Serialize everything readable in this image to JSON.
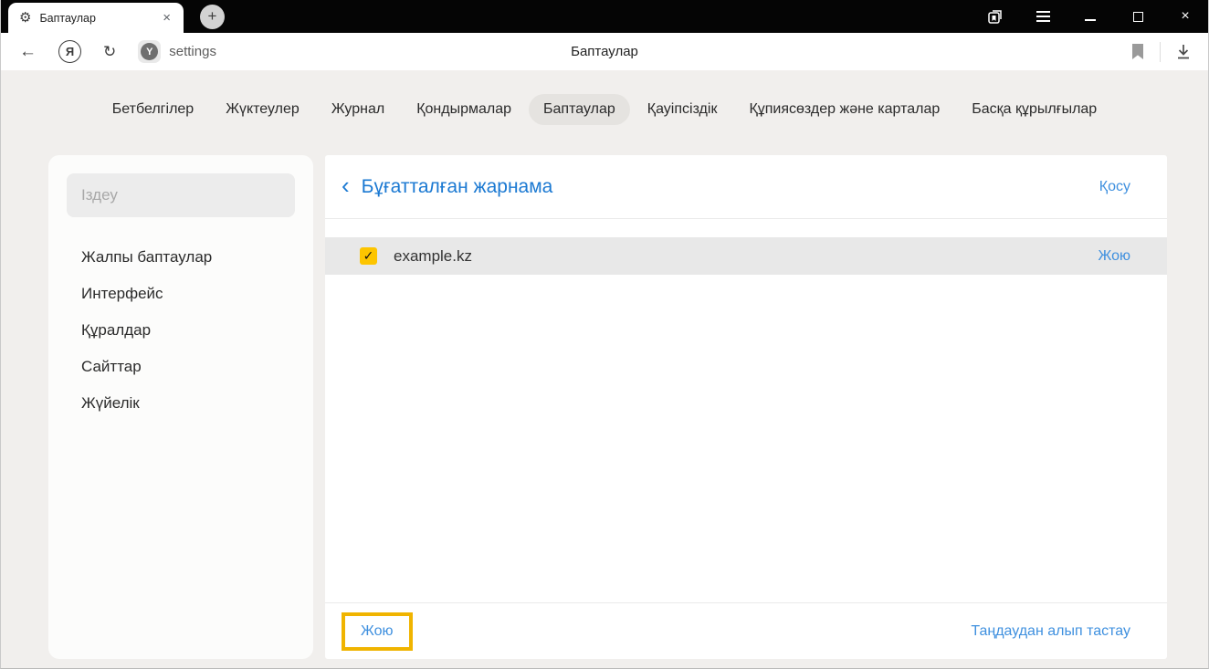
{
  "colors": {
    "accent_blue": "#1b79d2",
    "link_blue": "#3f90df",
    "checkbox_yellow": "#fdc500",
    "highlight_yellow": "#f0b400",
    "tabbar_black": "#050505",
    "row_gray": "#e8e8e8"
  },
  "icons": {
    "gear": "⚙",
    "close_tab": "×",
    "new_tab": "+",
    "back_arrow": "←",
    "refresh": "↻",
    "ya_letter": "Я",
    "protect_letter": "Y",
    "back_chevron": "‹",
    "checkmark": "✓"
  },
  "tab_bar": {
    "tab_title": "Баптаулар"
  },
  "toolbar": {
    "url_text": "settings",
    "page_title": "Баптаулар"
  },
  "nav": {
    "items": [
      {
        "label": "Бетбелгілер",
        "selected": false
      },
      {
        "label": "Жүктеулер",
        "selected": false
      },
      {
        "label": "Журнал",
        "selected": false
      },
      {
        "label": "Қондырмалар",
        "selected": false
      },
      {
        "label": "Баптаулар",
        "selected": true
      },
      {
        "label": "Қауіпсіздік",
        "selected": false
      },
      {
        "label": "Құпиясөздер және карталар",
        "selected": false
      },
      {
        "label": "Басқа құрылғылар",
        "selected": false
      }
    ]
  },
  "sidebar": {
    "search_placeholder": "Іздеу",
    "items": [
      {
        "label": "Жалпы баптаулар"
      },
      {
        "label": "Интерфейс"
      },
      {
        "label": "Құралдар"
      },
      {
        "label": "Сайттар"
      },
      {
        "label": "Жүйелік"
      }
    ]
  },
  "main": {
    "title": "Бұғатталған жарнама",
    "add_label": "Қосу",
    "rows": [
      {
        "domain": "example.kz",
        "checked": true,
        "action_label": "Жою"
      }
    ],
    "footer": {
      "delete_label": "Жою",
      "deselect_label": "Таңдаудан алып тастау"
    }
  }
}
